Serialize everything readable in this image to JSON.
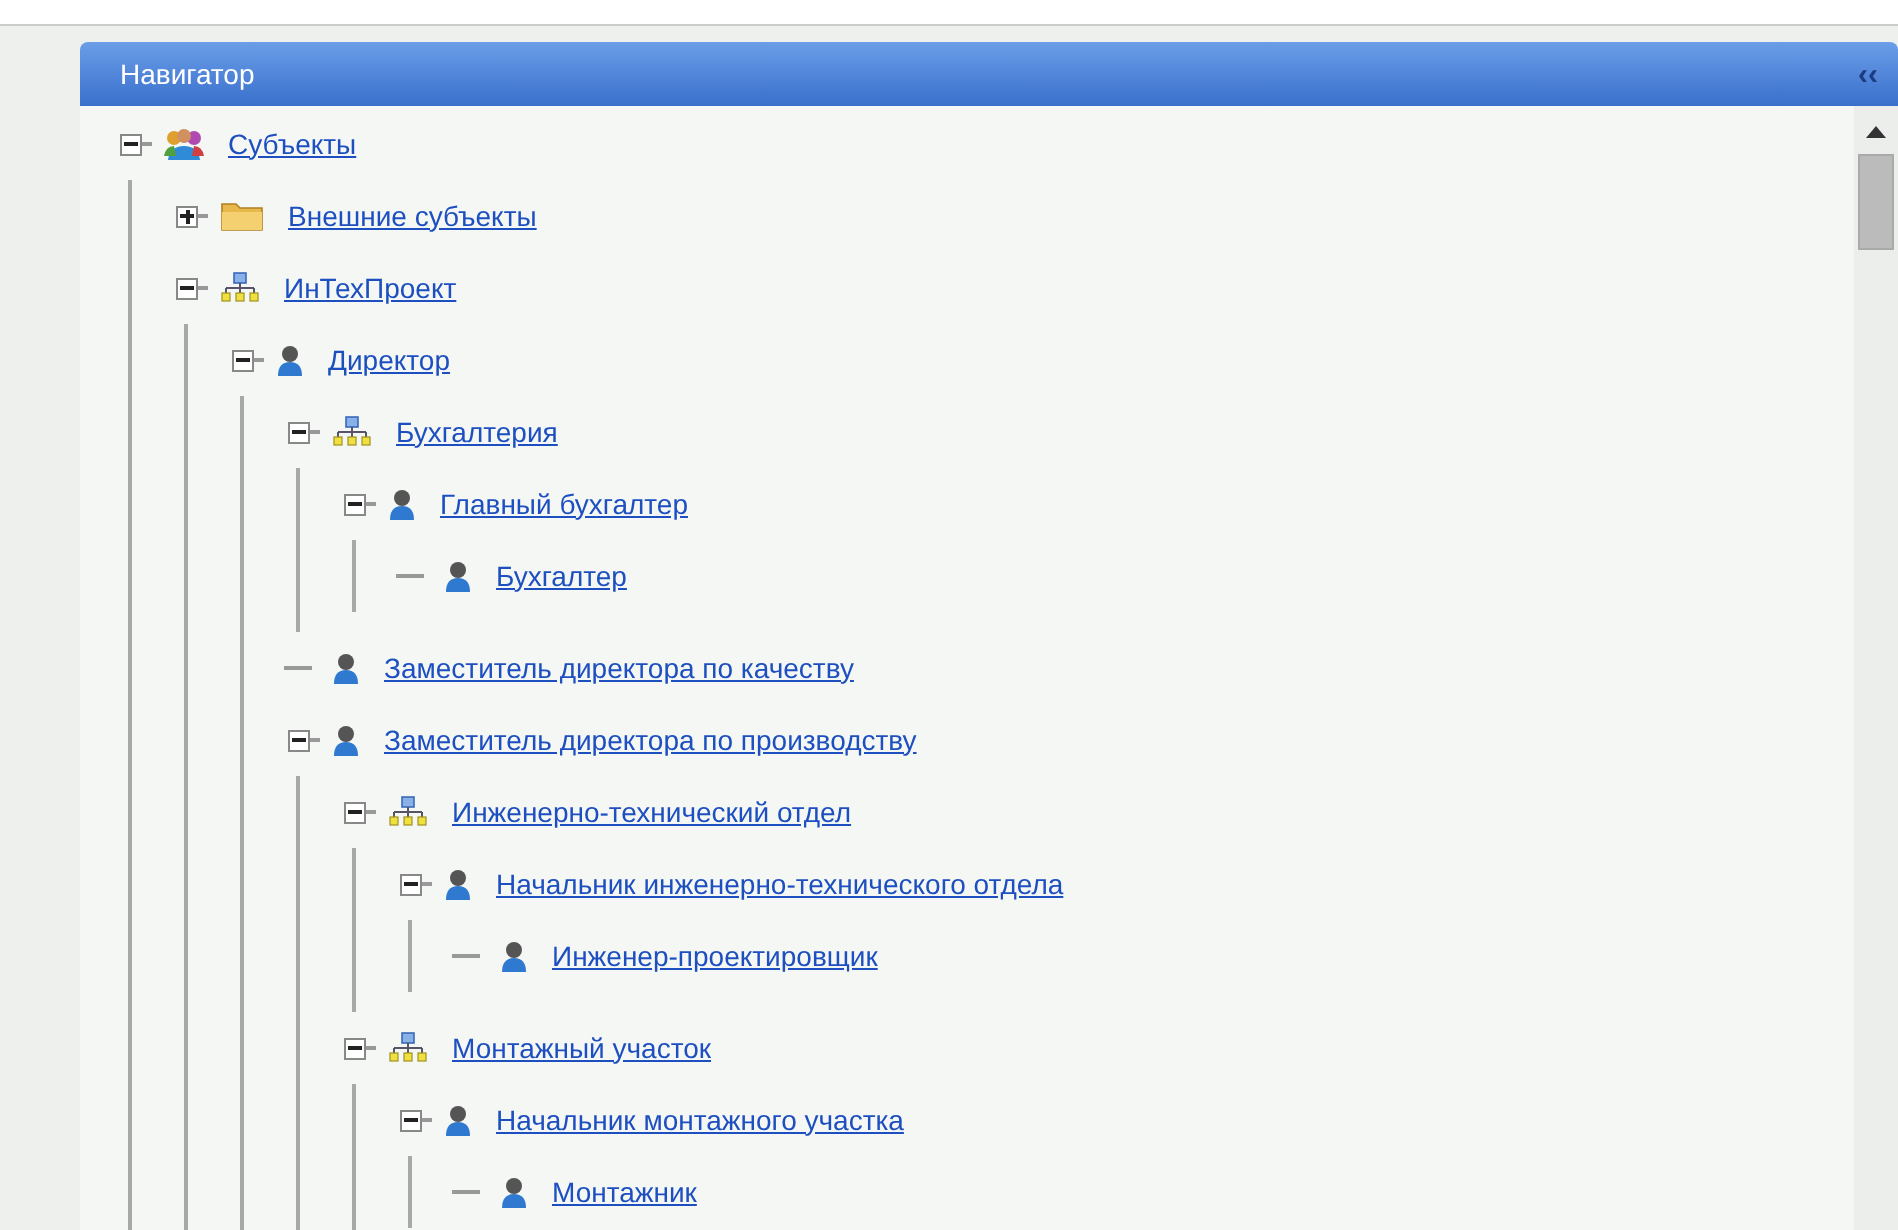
{
  "panel": {
    "title": "Навигатор",
    "collapse_glyph": "‹‹"
  },
  "tree": [
    {
      "label": "Субъекты",
      "kind": "group",
      "expanded": true,
      "children": [
        {
          "label": "Внешние субъекты",
          "kind": "folder",
          "expanded": false
        },
        {
          "label": "ИнТехПроект",
          "kind": "unit",
          "expanded": true,
          "children": [
            {
              "label": "Директор",
              "kind": "person",
              "expanded": true,
              "children": [
                {
                  "label": "Бухгалтерия",
                  "kind": "unit",
                  "expanded": true,
                  "children": [
                    {
                      "label": "Главный бухгалтер",
                      "kind": "person",
                      "expanded": true,
                      "children": [
                        {
                          "label": "Бухгалтер",
                          "kind": "person"
                        }
                      ]
                    }
                  ]
                },
                {
                  "label": "Заместитель директора по качеству",
                  "kind": "person"
                },
                {
                  "label": "Заместитель директора по производству",
                  "kind": "person",
                  "expanded": true,
                  "children": [
                    {
                      "label": "Инженерно-технический отдел",
                      "kind": "unit",
                      "expanded": true,
                      "children": [
                        {
                          "label": "Начальник инженерно-технического отдела",
                          "kind": "person",
                          "expanded": true,
                          "children": [
                            {
                              "label": "Инженер-проектировщик",
                              "kind": "person"
                            }
                          ]
                        }
                      ]
                    },
                    {
                      "label": "Монтажный участок",
                      "kind": "unit",
                      "expanded": true,
                      "children": [
                        {
                          "label": "Начальник монтажного участка",
                          "kind": "person",
                          "expanded": true,
                          "children": [
                            {
                              "label": "Монтажник",
                              "kind": "person"
                            }
                          ]
                        }
                      ]
                    }
                  ]
                }
              ]
            }
          ]
        }
      ]
    }
  ]
}
